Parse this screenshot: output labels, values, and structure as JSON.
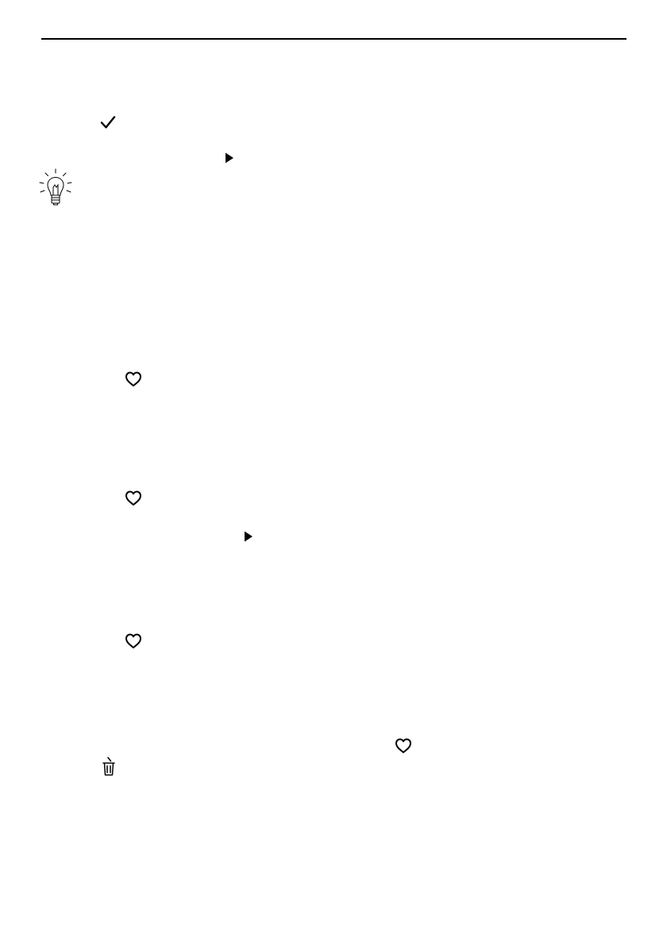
{
  "page": {
    "background": "#ffffff",
    "ink": "#000000"
  },
  "icons": [
    "check-icon",
    "play-icon",
    "lightbulb-tip-icon",
    "heart-icon",
    "heart-icon",
    "play-icon",
    "heart-icon",
    "heart-icon",
    "trash-icon"
  ]
}
